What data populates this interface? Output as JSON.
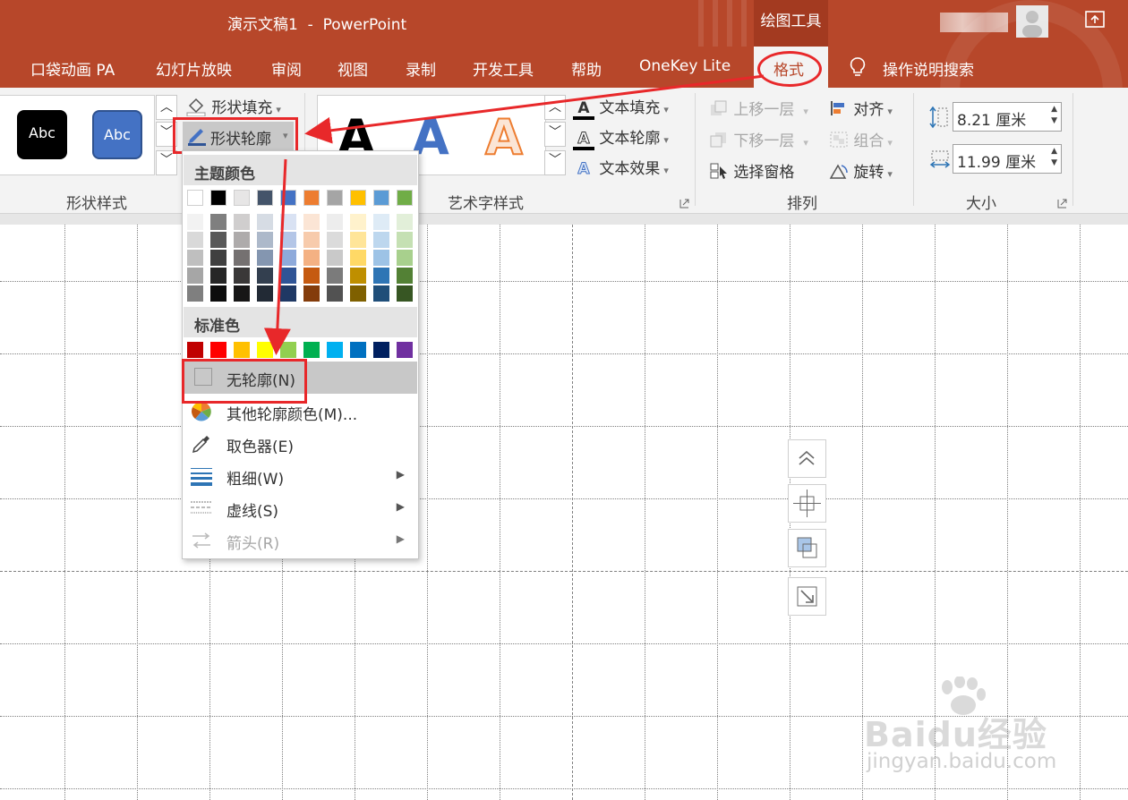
{
  "window": {
    "title": "演示文稿1  -  PowerPoint",
    "contextual_tab_group": "绘图工具"
  },
  "tabs": [
    "口袋动画 PA",
    "幻灯片放映",
    "审阅",
    "视图",
    "录制",
    "开发工具",
    "帮助",
    "OneKey Lite",
    "格式"
  ],
  "tell_me": "操作说明搜索",
  "ribbon": {
    "shape_styles": {
      "label": "形状样式",
      "preview1": "Abc",
      "preview2": "Abc",
      "fill": "形状填充",
      "outline": "形状轮廓"
    },
    "wordart": {
      "label": "艺术字样式",
      "text_fill": "文本填充",
      "text_outline": "文本轮廓",
      "text_effects": "文本效果"
    },
    "arrange": {
      "label": "排列",
      "bring_forward": "上移一层",
      "send_backward": "下移一层",
      "selection_pane": "选择窗格",
      "align": "对齐",
      "group": "组合",
      "rotate": "旋转"
    },
    "size": {
      "label": "大小",
      "height": "8.21 厘米",
      "width": "11.99 厘米"
    }
  },
  "menu": {
    "theme_colors_header": "主题颜色",
    "standard_colors_header": "标准色",
    "theme_top_row": [
      "#ffffff",
      "#000000",
      "#e7e6e6",
      "#44546a",
      "#4472c4",
      "#ed7d31",
      "#a5a5a5",
      "#ffc000",
      "#5b9bd5",
      "#70ad47"
    ],
    "theme_shades": [
      [
        "#f2f2f2",
        "#d9d9d9",
        "#bfbfbf",
        "#a6a6a6",
        "#7f7f7f"
      ],
      [
        "#7f7f7f",
        "#595959",
        "#404040",
        "#262626",
        "#0d0d0d"
      ],
      [
        "#d0cece",
        "#aeabab",
        "#757171",
        "#3a3838",
        "#171616"
      ],
      [
        "#d6dce4",
        "#adb9ca",
        "#8496b0",
        "#333f4f",
        "#222a35"
      ],
      [
        "#d9e2f3",
        "#b4c6e7",
        "#8eaadb",
        "#2f5496",
        "#1f3864"
      ],
      [
        "#fbe5d5",
        "#f7cbac",
        "#f4b183",
        "#c55a11",
        "#843c0b"
      ],
      [
        "#ededed",
        "#dbdbdb",
        "#c9c9c9",
        "#7b7b7b",
        "#525252"
      ],
      [
        "#fff2cc",
        "#ffe599",
        "#ffd966",
        "#bf8f00",
        "#7f6000"
      ],
      [
        "#deebf6",
        "#bdd7ee",
        "#9dc3e6",
        "#2e75b5",
        "#1f4e79"
      ],
      [
        "#e2efd9",
        "#c5e0b3",
        "#a8d08d",
        "#538135",
        "#375623"
      ]
    ],
    "standard_colors": [
      "#c00000",
      "#ff0000",
      "#ffc000",
      "#ffff00",
      "#92d050",
      "#00b050",
      "#00b0f0",
      "#0070c0",
      "#002060",
      "#7030a0"
    ],
    "items": {
      "no_outline": "无轮廓(N)",
      "more_colors": "其他轮廓颜色(M)...",
      "eyedropper": "取色器(E)",
      "weight": "粗细(W)",
      "dashes": "虚线(S)",
      "arrows": "箭头(R)"
    }
  },
  "watermark": {
    "brand": "Baidu经验",
    "url": "jingyan.baidu.com"
  },
  "colors": {
    "accent": "#b7472a",
    "annotation": "#e8282a",
    "hover": "#c8c8c8"
  }
}
